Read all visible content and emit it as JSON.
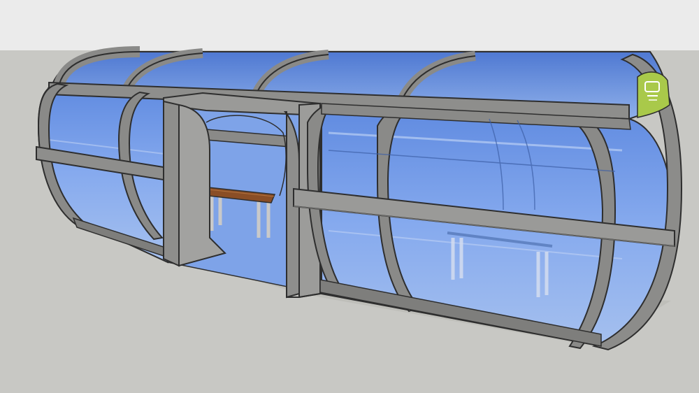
{
  "scene": {
    "sky_color": "#ebebeb",
    "ground_color": "#c8c8c4",
    "frame_color": "#8a8a88",
    "frame_dark": "#5c5c5a",
    "frame_edge": "#2e2e2e",
    "glass_color": "#6f98e6",
    "glass_light": "#9cbbf0",
    "bench_seat_color": "#8a4e26",
    "logo_color": "#a9c94a",
    "logo_icon": "tram-icon"
  }
}
